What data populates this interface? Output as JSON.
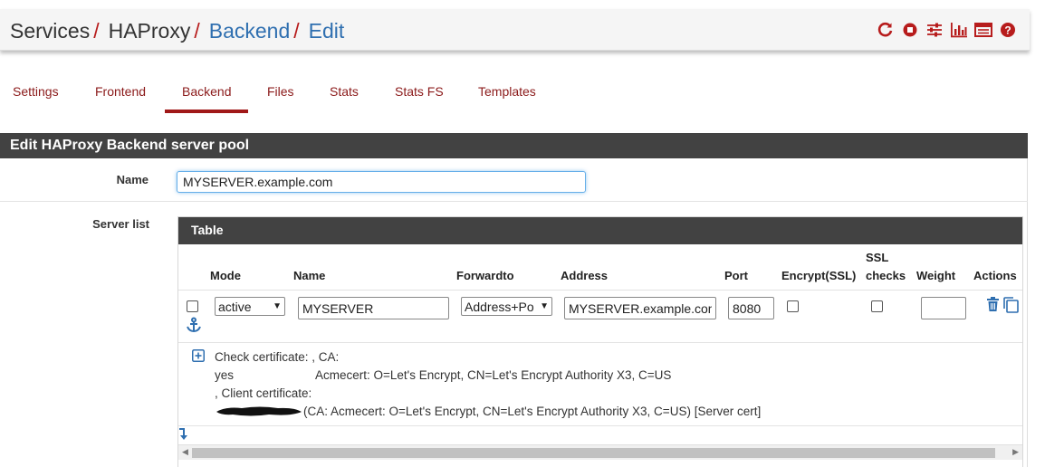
{
  "breadcrumb": {
    "items": [
      {
        "label": "Services",
        "link": false
      },
      {
        "label": "HAProxy",
        "link": false
      },
      {
        "label": "Backend",
        "link": true
      },
      {
        "label": "Edit",
        "link": true
      }
    ],
    "separator": "/"
  },
  "header_icons": [
    "restart-icon",
    "stop-icon",
    "settings-sliders-icon",
    "chart-icon",
    "log-icon",
    "help-icon"
  ],
  "tabs": [
    {
      "label": "Settings",
      "active": false
    },
    {
      "label": "Frontend",
      "active": false
    },
    {
      "label": "Backend",
      "active": true
    },
    {
      "label": "Files",
      "active": false
    },
    {
      "label": "Stats",
      "active": false
    },
    {
      "label": "Stats FS",
      "active": false
    },
    {
      "label": "Templates",
      "active": false
    }
  ],
  "panel": {
    "title": "Edit HAProxy Backend server pool",
    "name_label": "Name",
    "name_value": "MYSERVER.example.com",
    "server_list_label": "Server list"
  },
  "table": {
    "title": "Table",
    "columns": {
      "mode": "Mode",
      "name": "Name",
      "forwardto": "Forwardto",
      "address": "Address",
      "port": "Port",
      "encrypt": "Encrypt(SSL)",
      "ssl_checks_1": "SSL",
      "ssl_checks_2": "checks",
      "weight": "Weight",
      "actions": "Actions"
    },
    "row": {
      "selected": false,
      "mode": "active",
      "name": "MYSERVER",
      "forwardto": "Address+Po",
      "address": "MYSERVER.example.com",
      "port": "8080",
      "encrypt": false,
      "ssl_checks": false,
      "weight": ""
    },
    "details": {
      "line1": "Check certificate: , CA:",
      "line2_left": "yes",
      "line2_right": "Acmecert: O=Let's Encrypt, CN=Let's Encrypt Authority X3, C=US",
      "line3": ", Client certificate:",
      "line4": "(CA: Acmecert: O=Let's Encrypt, CN=Let's Encrypt Authority X3, C=US) [Server cert]"
    }
  },
  "colors": {
    "accent_red": "#b71c1c",
    "link_blue": "#2f6fb0",
    "panel_dark": "#424242"
  }
}
